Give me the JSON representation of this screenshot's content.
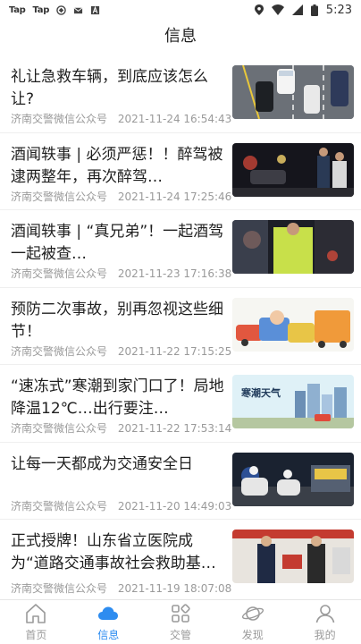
{
  "status_bar": {
    "left_tags": [
      "Tap",
      "Tap"
    ],
    "time": "5:23"
  },
  "page_title": "信息",
  "news": [
    {
      "title": "礼让急救车辆，到底应该怎么让?",
      "source": "济南交警微信公众号",
      "time": "2021-11-24 16:54:43"
    },
    {
      "title": "酒闻轶事 | 必须严惩！！醉驾被逮两整年，再次醉驾…",
      "source": "济南交警微信公众号",
      "time": "2021-11-24 17:25:46"
    },
    {
      "title": "酒闻轶事 | “真兄弟”！一起酒驾一起被查…",
      "source": "济南交警微信公众号",
      "time": "2021-11-23 17:16:38"
    },
    {
      "title": "预防二次事故，别再忽视这些细节！",
      "source": "济南交警微信公众号",
      "time": "2021-11-22 17:15:25"
    },
    {
      "title": "“速冻式”寒潮到家门口了！局地降温12℃…出行要注…",
      "source": "济南交警微信公众号",
      "time": "2021-11-22 17:53:14"
    },
    {
      "title": "让每一天都成为交通安全日",
      "source": "济南交警微信公众号",
      "time": "2021-11-20 14:49:03"
    },
    {
      "title": "正式授牌！山东省立医院成为“道路交通事故社会救助基…",
      "source": "济南交警微信公众号",
      "time": "2021-11-19 18:07:08"
    }
  ],
  "thumb_text": {
    "cold_wave_title": "寒潮天气"
  },
  "tabs": [
    {
      "label": "首页",
      "icon": "home-icon",
      "active": false
    },
    {
      "label": "信息",
      "icon": "cloud-icon",
      "active": true
    },
    {
      "label": "交管",
      "icon": "grid-icon",
      "active": false
    },
    {
      "label": "发现",
      "icon": "planet-icon",
      "active": false
    },
    {
      "label": "我的",
      "icon": "user-icon",
      "active": false
    }
  ],
  "colors": {
    "accent": "#2d8cf0",
    "inactive": "#9a9a9a"
  }
}
